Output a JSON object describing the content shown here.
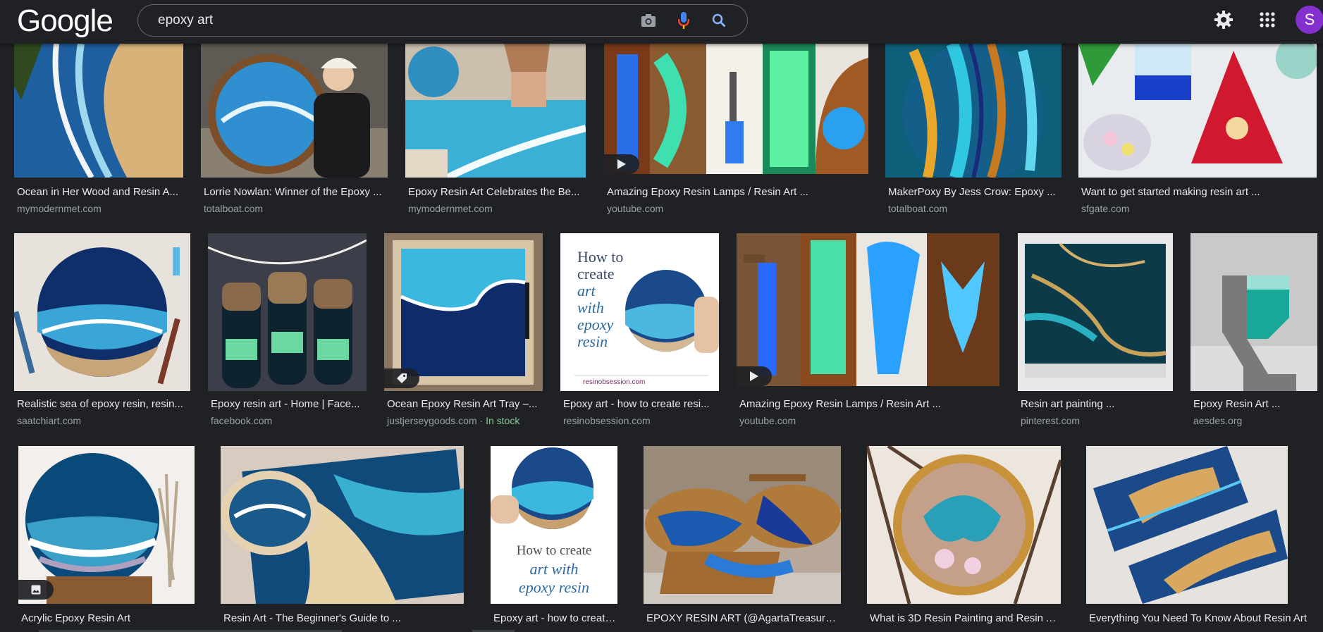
{
  "header": {
    "logo_text": "Google",
    "search_query": "epoxy art",
    "icons": [
      "camera-icon",
      "microphone-icon",
      "search-icon",
      "gear-icon",
      "apps-grid-icon"
    ],
    "avatar_letter": "S",
    "avatar_color": "#8430ce"
  },
  "results": [
    {
      "title": "Ocean in Her Wood and Resin A...",
      "source": "mymodernmet.com"
    },
    {
      "title": "Lorrie Nowlan: Winner of the Epoxy ...",
      "source": "totalboat.com"
    },
    {
      "title": "Epoxy Resin Art Celebrates the Be...",
      "source": "mymodernmet.com"
    },
    {
      "title": "Amazing Epoxy Resin Lamps / Resin Art ...",
      "source": "youtube.com"
    },
    {
      "title": "MakerPoxy By Jess Crow: Epoxy ...",
      "source": "totalboat.com"
    },
    {
      "title": "Want to get started making resin art ...",
      "source": "sfgate.com"
    },
    {
      "title": "Realistic sea of epoxy resin, resin...",
      "source": "saatchiart.com"
    },
    {
      "title": "Epoxy resin art - Home | Face...",
      "source": "facebook.com"
    },
    {
      "title": "Ocean Epoxy Resin Art Tray –...",
      "source": "justjerseygoods.com",
      "stock": "In stock"
    },
    {
      "title": "Epoxy art - how to create resi...",
      "source": "resinobsession.com",
      "thumb_text": [
        "How to",
        "create",
        "art",
        "with",
        "epoxy",
        "resin",
        "resinobsession.com"
      ]
    },
    {
      "title": "Amazing Epoxy Resin Lamps / Resin Art ...",
      "source": "youtube.com"
    },
    {
      "title": "Resin art painting ...",
      "source": "pinterest.com"
    },
    {
      "title": "Epoxy Resin Art ...",
      "source": "aesdes.org"
    },
    {
      "title": "Acrylic Epoxy Resin Art",
      "source": ""
    },
    {
      "title": "Resin Art - The Beginner's Guide to ...",
      "source": ""
    },
    {
      "title": "Epoxy art - how to create...",
      "source": "",
      "thumb_text": [
        "How to create",
        "art with",
        "epoxy resin"
      ]
    },
    {
      "title": "EPOXY RESIN ART (@AgartaTreasures ...",
      "source": ""
    },
    {
      "title": "What is 3D Resin Painting and Resin A...",
      "source": ""
    },
    {
      "title": "Everything You Need To Know About Resin Art",
      "source": ""
    }
  ]
}
